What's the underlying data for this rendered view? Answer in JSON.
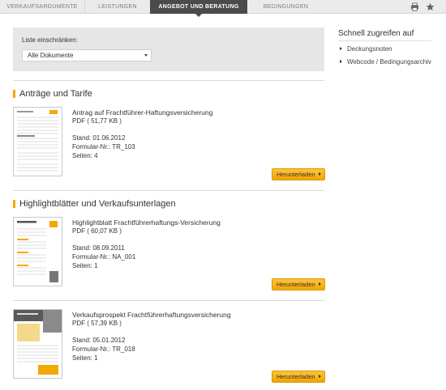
{
  "tabs": [
    {
      "label": "VERKAUFSARGUMENTE",
      "active": false
    },
    {
      "label": "LEISTUNGEN",
      "active": false
    },
    {
      "label": "ANGEBOT UND BERATUNG",
      "active": true
    },
    {
      "label": "BEDINGUNGEN",
      "active": false
    }
  ],
  "toolbar": {
    "print_icon": "print-icon",
    "favorite_icon": "star-icon"
  },
  "filter": {
    "label": "Liste einschränken:",
    "selected": "Alle Dokumente"
  },
  "sidebar": {
    "title": "Schnell zugreifen auf",
    "items": [
      "Deckungsnoten",
      "Webcode / Bedingungsarchiv"
    ]
  },
  "sections": [
    {
      "heading": "Anträge und Tarife",
      "documents": [
        {
          "title": "Antrag auf Frachtführer-Haftungsversicherung",
          "format": "PDF ( 51,77 KB )",
          "stand": "Stand: 01.06.2012",
          "formular_label": "Formular-Nr.:",
          "formular": "TR_103",
          "seiten": "Seiten: 4",
          "button": "Herunterladen"
        }
      ]
    },
    {
      "heading": "Highlightblätter und Verkaufsunterlagen",
      "documents": [
        {
          "title": "Highlightblatt Frachtführerhaftungs-Versicherung",
          "format": "PDF ( 60,07 KB )",
          "stand": "Stand: 08.09.2011",
          "formular_label": "Formular-Nr.:",
          "formular": "NA_001",
          "seiten": "Seiten: 1",
          "button": "Herunterladen"
        },
        {
          "title": "Verkaufsprospekt Frachtführerhaftungsversicherung",
          "format": "PDF ( 57,39 KB )",
          "stand": "Stand: 05.01.2012",
          "formular_label": "Formular-Nr.:",
          "formular": "TR_018",
          "seiten": "Seiten: 1",
          "button": "Herunterladen"
        }
      ]
    }
  ],
  "colors": {
    "accent": "#f2a900",
    "active_tab": "#4b4b4b",
    "filter_bg": "#e6e6e6"
  }
}
